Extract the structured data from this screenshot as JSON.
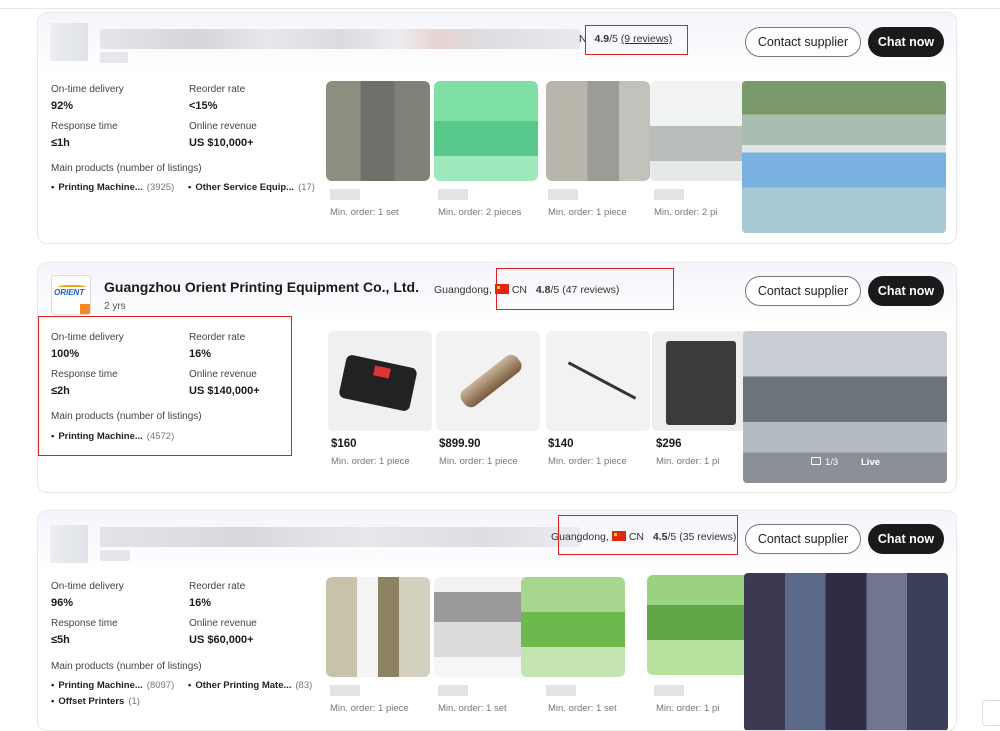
{
  "cards": [
    {
      "rating": {
        "score": "4.9",
        "out_of": "/5",
        "reviews": "(9 reviews)"
      },
      "partial_letter": "N",
      "stats": {
        "on_time_label": "On-time delivery",
        "on_time": "92%",
        "reorder_label": "Reorder rate",
        "reorder": "<15%",
        "response_label": "Response time",
        "response": "≤1h",
        "revenue_label": "Online revenue",
        "revenue": "US $10,000+"
      },
      "main_products_label": "Main products (number of listings)",
      "main_products": [
        {
          "name": "Printing Machine...",
          "count": "(3925)"
        },
        {
          "name": "Other Service Equip...",
          "count": "(17)"
        }
      ],
      "products": [
        {
          "min_order": "Min. order: 1 set"
        },
        {
          "min_order": "Min. order: 2 pieces"
        },
        {
          "min_order": "Min. order: 1 piece"
        },
        {
          "min_order": "Min. order: 2 pi"
        }
      ]
    },
    {
      "company": "Guangzhou Orient Printing Equipment Co., Ltd.",
      "location": "Guangdong,",
      "country": "CN",
      "years": "2 yrs",
      "logo_text": "ORIENT",
      "rating": {
        "score": "4.8",
        "out_of": "/5",
        "reviews": "(47 reviews)"
      },
      "stats": {
        "on_time_label": "On-time delivery",
        "on_time": "100%",
        "reorder_label": "Reorder rate",
        "reorder": "16%",
        "response_label": "Response time",
        "response": "≤2h",
        "revenue_label": "Online revenue",
        "revenue": "US $140,000+"
      },
      "main_products_label": "Main products (number of listings)",
      "main_products": [
        {
          "name": "Printing Machine...",
          "count": "(4572)"
        }
      ],
      "products": [
        {
          "price": "$160",
          "min_order": "Min. order: 1 piece"
        },
        {
          "price": "$899.90",
          "min_order": "Min. order: 1 piece"
        },
        {
          "price": "$140",
          "min_order": "Min. order: 1 piece"
        },
        {
          "price": "$296",
          "min_order": "Min. order: 1 pi"
        }
      ],
      "gallery": {
        "counter": "1/3",
        "live": "Live"
      }
    },
    {
      "location": "Guangdong,",
      "country": "CN",
      "rating": {
        "score": "4.5",
        "out_of": "/5",
        "reviews": "(35 reviews)"
      },
      "stats": {
        "on_time_label": "On-time delivery",
        "on_time": "96%",
        "reorder_label": "Reorder rate",
        "reorder": "16%",
        "response_label": "Response time",
        "response": "≤5h",
        "revenue_label": "Online revenue",
        "revenue": "US $60,000+"
      },
      "main_products_label": "Main products (number of listings)",
      "main_products": [
        {
          "name": "Printing Machine...",
          "count": "(8097)"
        },
        {
          "name": "Other Printing Mate...",
          "count": "(83)"
        },
        {
          "name": "Offset Printers",
          "count": "(1)"
        }
      ],
      "products": [
        {
          "min_order": "Min. order: 1 piece"
        },
        {
          "min_order": "Min. order: 1 set"
        },
        {
          "min_order": "Min. order: 1 set"
        },
        {
          "min_order": "Min. order: 1 pi"
        }
      ]
    }
  ],
  "buttons": {
    "contact": "Contact supplier",
    "chat": "Chat now"
  },
  "colors": {
    "highlight": "#e02020",
    "chat_button": "#1a1a1a",
    "flag": "#de2910"
  }
}
